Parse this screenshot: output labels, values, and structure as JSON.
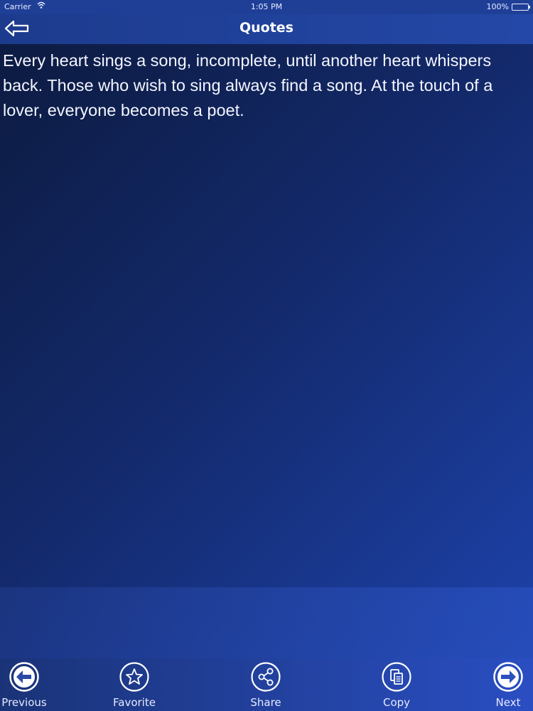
{
  "status_bar": {
    "carrier": "Carrier",
    "time": "1:05 PM",
    "battery": "100%"
  },
  "nav": {
    "title": "Quotes"
  },
  "quote": {
    "text": "Every heart sings a song, incomplete, until another heart whispers back. Those who wish to sing always find a song. At the touch of a lover, everyone becomes a poet."
  },
  "toolbar": {
    "previous_label": "Previous",
    "favorite_label": "Favorite",
    "share_label": "Share",
    "copy_label": "Copy",
    "next_label": "Next"
  },
  "icons": {
    "back": "arrow-left-icon",
    "previous": "circle-arrow-left-icon",
    "favorite": "star-icon",
    "share": "share-icon",
    "copy": "copy-icon",
    "next": "circle-arrow-right-icon"
  }
}
